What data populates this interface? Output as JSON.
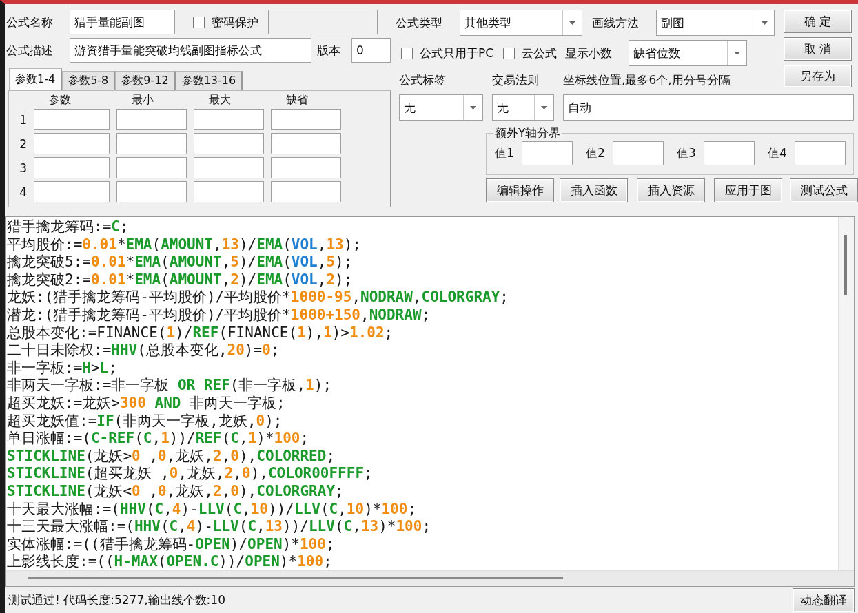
{
  "formula": {
    "name_label": "公式名称",
    "name": "猎手量能副图",
    "password": {
      "label": "密码保护",
      "checked": false
    },
    "desc_label": "公式描述",
    "description": "游资猎手量能突破均线副图指标公式",
    "version_label": "版本",
    "version": "0"
  },
  "param_tabs": [
    {
      "label": "参数1-4",
      "selected": true
    },
    {
      "label": "参数5-8",
      "selected": false
    },
    {
      "label": "参数9-12",
      "selected": false
    },
    {
      "label": "参数13-16",
      "selected": false
    }
  ],
  "param_columns": [
    "参数",
    "最小",
    "最大",
    "缺省"
  ],
  "param_rows": [
    "1",
    "2",
    "3",
    "4"
  ],
  "type": {
    "label": "公式类型",
    "value": "其他类型"
  },
  "draw_method": {
    "label": "画线方法",
    "value": "副图"
  },
  "options": [
    {
      "label": "公式只用于PC",
      "checked": false
    },
    {
      "label": "云公式",
      "checked": false
    }
  ],
  "decimals": {
    "label": "显示小数",
    "value": "缺省位数"
  },
  "side_buttons": [
    "确 定",
    "取 消",
    "另存为"
  ],
  "tag": {
    "label": "公式标签",
    "value": "无"
  },
  "trade_rule": {
    "label": "交易法则",
    "value": "无"
  },
  "axis": {
    "label": "坐标线位置,最多6个,用分号分隔",
    "value": "自动"
  },
  "extra_y": {
    "title": "额外Y轴分界",
    "fields": [
      "值1",
      "值2",
      "值3",
      "值4"
    ]
  },
  "action_buttons": [
    "编辑操作",
    "插入函数",
    "插入资源",
    "应用于图",
    "测试公式"
  ],
  "code": [
    [
      {
        "kind": "p",
        "text": "猎手擒龙筹码:="
      },
      {
        "kind": "f",
        "text": "C"
      },
      {
        "kind": "p",
        "text": ";"
      }
    ],
    [
      {
        "kind": "p",
        "text": "平均股价:="
      },
      {
        "kind": "n",
        "text": "0.01"
      },
      {
        "kind": "p",
        "text": "*"
      },
      {
        "kind": "f",
        "text": "EMA"
      },
      {
        "kind": "p",
        "text": "("
      },
      {
        "kind": "f",
        "text": "AMOUNT"
      },
      {
        "kind": "p",
        "text": ","
      },
      {
        "kind": "n",
        "text": "13"
      },
      {
        "kind": "p",
        "text": ")/"
      },
      {
        "kind": "f",
        "text": "EMA"
      },
      {
        "kind": "p",
        "text": "("
      },
      {
        "kind": "v",
        "text": "VOL"
      },
      {
        "kind": "p",
        "text": ","
      },
      {
        "kind": "n",
        "text": "13"
      },
      {
        "kind": "p",
        "text": ");"
      }
    ],
    [
      {
        "kind": "p",
        "text": "擒龙突破5:="
      },
      {
        "kind": "n",
        "text": "0.01"
      },
      {
        "kind": "p",
        "text": "*"
      },
      {
        "kind": "f",
        "text": "EMA"
      },
      {
        "kind": "p",
        "text": "("
      },
      {
        "kind": "f",
        "text": "AMOUNT"
      },
      {
        "kind": "p",
        "text": ","
      },
      {
        "kind": "n",
        "text": "5"
      },
      {
        "kind": "p",
        "text": ")/"
      },
      {
        "kind": "f",
        "text": "EMA"
      },
      {
        "kind": "p",
        "text": "("
      },
      {
        "kind": "v",
        "text": "VOL"
      },
      {
        "kind": "p",
        "text": ","
      },
      {
        "kind": "n",
        "text": "5"
      },
      {
        "kind": "p",
        "text": ");"
      }
    ],
    [
      {
        "kind": "p",
        "text": "擒龙突破2:="
      },
      {
        "kind": "n",
        "text": "0.01"
      },
      {
        "kind": "p",
        "text": "*"
      },
      {
        "kind": "f",
        "text": "EMA"
      },
      {
        "kind": "p",
        "text": "("
      },
      {
        "kind": "f",
        "text": "AMOUNT"
      },
      {
        "kind": "p",
        "text": ","
      },
      {
        "kind": "n",
        "text": "2"
      },
      {
        "kind": "p",
        "text": ")/"
      },
      {
        "kind": "f",
        "text": "EMA"
      },
      {
        "kind": "p",
        "text": "("
      },
      {
        "kind": "v",
        "text": "VOL"
      },
      {
        "kind": "p",
        "text": ","
      },
      {
        "kind": "n",
        "text": "2"
      },
      {
        "kind": "p",
        "text": ");"
      }
    ],
    [
      {
        "kind": "p",
        "text": "龙妖:(猎手擒龙筹码-平均股价)/平均股价*"
      },
      {
        "kind": "n",
        "text": "1000-95"
      },
      {
        "kind": "p",
        "text": ","
      },
      {
        "kind": "f",
        "text": "NODRAW"
      },
      {
        "kind": "p",
        "text": ","
      },
      {
        "kind": "f",
        "text": "COLORGRAY"
      },
      {
        "kind": "p",
        "text": ";"
      }
    ],
    [
      {
        "kind": "p",
        "text": "潜龙:(猎手擒龙筹码-平均股价)/平均股价*"
      },
      {
        "kind": "n",
        "text": "1000+150"
      },
      {
        "kind": "p",
        "text": ","
      },
      {
        "kind": "f",
        "text": "NODRAW"
      },
      {
        "kind": "p",
        "text": ";"
      }
    ],
    [
      {
        "kind": "p",
        "text": "总股本变化:=FINANCE("
      },
      {
        "kind": "n",
        "text": "1"
      },
      {
        "kind": "p",
        "text": ")/"
      },
      {
        "kind": "f",
        "text": "REF"
      },
      {
        "kind": "p",
        "text": "(FINANCE("
      },
      {
        "kind": "n",
        "text": "1"
      },
      {
        "kind": "p",
        "text": "),"
      },
      {
        "kind": "n",
        "text": "1"
      },
      {
        "kind": "p",
        "text": ")>"
      },
      {
        "kind": "n",
        "text": "1.02"
      },
      {
        "kind": "p",
        "text": ";"
      }
    ],
    [
      {
        "kind": "p",
        "text": "二十日未除权:="
      },
      {
        "kind": "f",
        "text": "HHV"
      },
      {
        "kind": "p",
        "text": "(总股本变化,"
      },
      {
        "kind": "n",
        "text": "20"
      },
      {
        "kind": "p",
        "text": ")="
      },
      {
        "kind": "n",
        "text": "0"
      },
      {
        "kind": "p",
        "text": ";"
      }
    ],
    [
      {
        "kind": "p",
        "text": "非一字板:="
      },
      {
        "kind": "f",
        "text": "H"
      },
      {
        "kind": "p",
        "text": ">"
      },
      {
        "kind": "f",
        "text": "L"
      },
      {
        "kind": "p",
        "text": ";"
      }
    ],
    [
      {
        "kind": "p",
        "text": "非两天一字板:=非一字板 "
      },
      {
        "kind": "f",
        "text": "OR REF"
      },
      {
        "kind": "p",
        "text": "(非一字板,"
      },
      {
        "kind": "n",
        "text": "1"
      },
      {
        "kind": "p",
        "text": ");"
      }
    ],
    [
      {
        "kind": "p",
        "text": "超买龙妖:=龙妖>"
      },
      {
        "kind": "n",
        "text": "300"
      },
      {
        "kind": "f",
        "text": " AND"
      },
      {
        "kind": "p",
        "text": " 非两天一字板;"
      }
    ],
    [
      {
        "kind": "p",
        "text": "超买龙妖值:="
      },
      {
        "kind": "f",
        "text": "IF"
      },
      {
        "kind": "p",
        "text": "(非两天一字板,龙妖,"
      },
      {
        "kind": "n",
        "text": "0"
      },
      {
        "kind": "p",
        "text": ");"
      }
    ],
    [
      {
        "kind": "p",
        "text": "单日涨幅:=("
      },
      {
        "kind": "f",
        "text": "C-REF"
      },
      {
        "kind": "p",
        "text": "("
      },
      {
        "kind": "f",
        "text": "C"
      },
      {
        "kind": "p",
        "text": ","
      },
      {
        "kind": "n",
        "text": "1"
      },
      {
        "kind": "p",
        "text": "))/"
      },
      {
        "kind": "f",
        "text": "REF"
      },
      {
        "kind": "p",
        "text": "("
      },
      {
        "kind": "f",
        "text": "C"
      },
      {
        "kind": "p",
        "text": ","
      },
      {
        "kind": "n",
        "text": "1"
      },
      {
        "kind": "p",
        "text": ")*"
      },
      {
        "kind": "n",
        "text": "100"
      },
      {
        "kind": "p",
        "text": ";"
      }
    ],
    [
      {
        "kind": "f",
        "text": "STICKLINE"
      },
      {
        "kind": "p",
        "text": "(龙妖>"
      },
      {
        "kind": "n",
        "text": "0"
      },
      {
        "kind": "p",
        "text": " ,"
      },
      {
        "kind": "n",
        "text": "0"
      },
      {
        "kind": "p",
        "text": ",龙妖,"
      },
      {
        "kind": "n",
        "text": "2"
      },
      {
        "kind": "p",
        "text": ","
      },
      {
        "kind": "n",
        "text": "0"
      },
      {
        "kind": "p",
        "text": "),"
      },
      {
        "kind": "f",
        "text": "COLORRED"
      },
      {
        "kind": "p",
        "text": ";"
      }
    ],
    [
      {
        "kind": "f",
        "text": "STICKLINE"
      },
      {
        "kind": "p",
        "text": "(超买龙妖 ,"
      },
      {
        "kind": "n",
        "text": "0"
      },
      {
        "kind": "p",
        "text": ",龙妖,"
      },
      {
        "kind": "n",
        "text": "2"
      },
      {
        "kind": "p",
        "text": ","
      },
      {
        "kind": "n",
        "text": "0"
      },
      {
        "kind": "p",
        "text": "),"
      },
      {
        "kind": "f",
        "text": "COLOR00FFFF"
      },
      {
        "kind": "p",
        "text": ";"
      }
    ],
    [
      {
        "kind": "f",
        "text": "STICKLINE"
      },
      {
        "kind": "p",
        "text": "(龙妖<"
      },
      {
        "kind": "n",
        "text": "0"
      },
      {
        "kind": "p",
        "text": " ,"
      },
      {
        "kind": "n",
        "text": "0"
      },
      {
        "kind": "p",
        "text": ",龙妖,"
      },
      {
        "kind": "n",
        "text": "2"
      },
      {
        "kind": "p",
        "text": ","
      },
      {
        "kind": "n",
        "text": "0"
      },
      {
        "kind": "p",
        "text": "),"
      },
      {
        "kind": "f",
        "text": "COLORGRAY"
      },
      {
        "kind": "p",
        "text": ";"
      }
    ],
    [
      {
        "kind": "p",
        "text": "十天最大涨幅:=("
      },
      {
        "kind": "f",
        "text": "HHV"
      },
      {
        "kind": "p",
        "text": "("
      },
      {
        "kind": "f",
        "text": "C"
      },
      {
        "kind": "p",
        "text": ","
      },
      {
        "kind": "n",
        "text": "4"
      },
      {
        "kind": "p",
        "text": ")-"
      },
      {
        "kind": "f",
        "text": "LLV"
      },
      {
        "kind": "p",
        "text": "("
      },
      {
        "kind": "f",
        "text": "C"
      },
      {
        "kind": "p",
        "text": ","
      },
      {
        "kind": "n",
        "text": "10"
      },
      {
        "kind": "p",
        "text": "))/"
      },
      {
        "kind": "f",
        "text": "LLV"
      },
      {
        "kind": "p",
        "text": "("
      },
      {
        "kind": "f",
        "text": "C"
      },
      {
        "kind": "p",
        "text": ","
      },
      {
        "kind": "n",
        "text": "10"
      },
      {
        "kind": "p",
        "text": ")*"
      },
      {
        "kind": "n",
        "text": "100"
      },
      {
        "kind": "p",
        "text": ";"
      }
    ],
    [
      {
        "kind": "p",
        "text": "十三天最大涨幅:=("
      },
      {
        "kind": "f",
        "text": "HHV"
      },
      {
        "kind": "p",
        "text": "("
      },
      {
        "kind": "f",
        "text": "C"
      },
      {
        "kind": "p",
        "text": ","
      },
      {
        "kind": "n",
        "text": "4"
      },
      {
        "kind": "p",
        "text": ")-"
      },
      {
        "kind": "f",
        "text": "LLV"
      },
      {
        "kind": "p",
        "text": "("
      },
      {
        "kind": "f",
        "text": "C"
      },
      {
        "kind": "p",
        "text": ","
      },
      {
        "kind": "n",
        "text": "13"
      },
      {
        "kind": "p",
        "text": "))/"
      },
      {
        "kind": "f",
        "text": "LLV"
      },
      {
        "kind": "p",
        "text": "("
      },
      {
        "kind": "f",
        "text": "C"
      },
      {
        "kind": "p",
        "text": ","
      },
      {
        "kind": "n",
        "text": "13"
      },
      {
        "kind": "p",
        "text": ")*"
      },
      {
        "kind": "n",
        "text": "100"
      },
      {
        "kind": "p",
        "text": ";"
      }
    ],
    [
      {
        "kind": "p",
        "text": "实体涨幅:=((猎手擒龙筹码-"
      },
      {
        "kind": "f",
        "text": "OPEN"
      },
      {
        "kind": "p",
        "text": ")/"
      },
      {
        "kind": "f",
        "text": "OPEN"
      },
      {
        "kind": "p",
        "text": ")*"
      },
      {
        "kind": "n",
        "text": "100"
      },
      {
        "kind": "p",
        "text": ";"
      }
    ],
    [
      {
        "kind": "p",
        "text": "上影线长度:=(("
      },
      {
        "kind": "f",
        "text": "H-MAX"
      },
      {
        "kind": "p",
        "text": "("
      },
      {
        "kind": "f",
        "text": "OPEN.C"
      },
      {
        "kind": "p",
        "text": "))/"
      },
      {
        "kind": "f",
        "text": "OPEN"
      },
      {
        "kind": "p",
        "text": ")*"
      },
      {
        "kind": "n",
        "text": "100"
      },
      {
        "kind": "p",
        "text": ";"
      }
    ]
  ],
  "status": "测试通过! 代码长度:5277,输出线个数:10",
  "translate_button": "动态翻译"
}
